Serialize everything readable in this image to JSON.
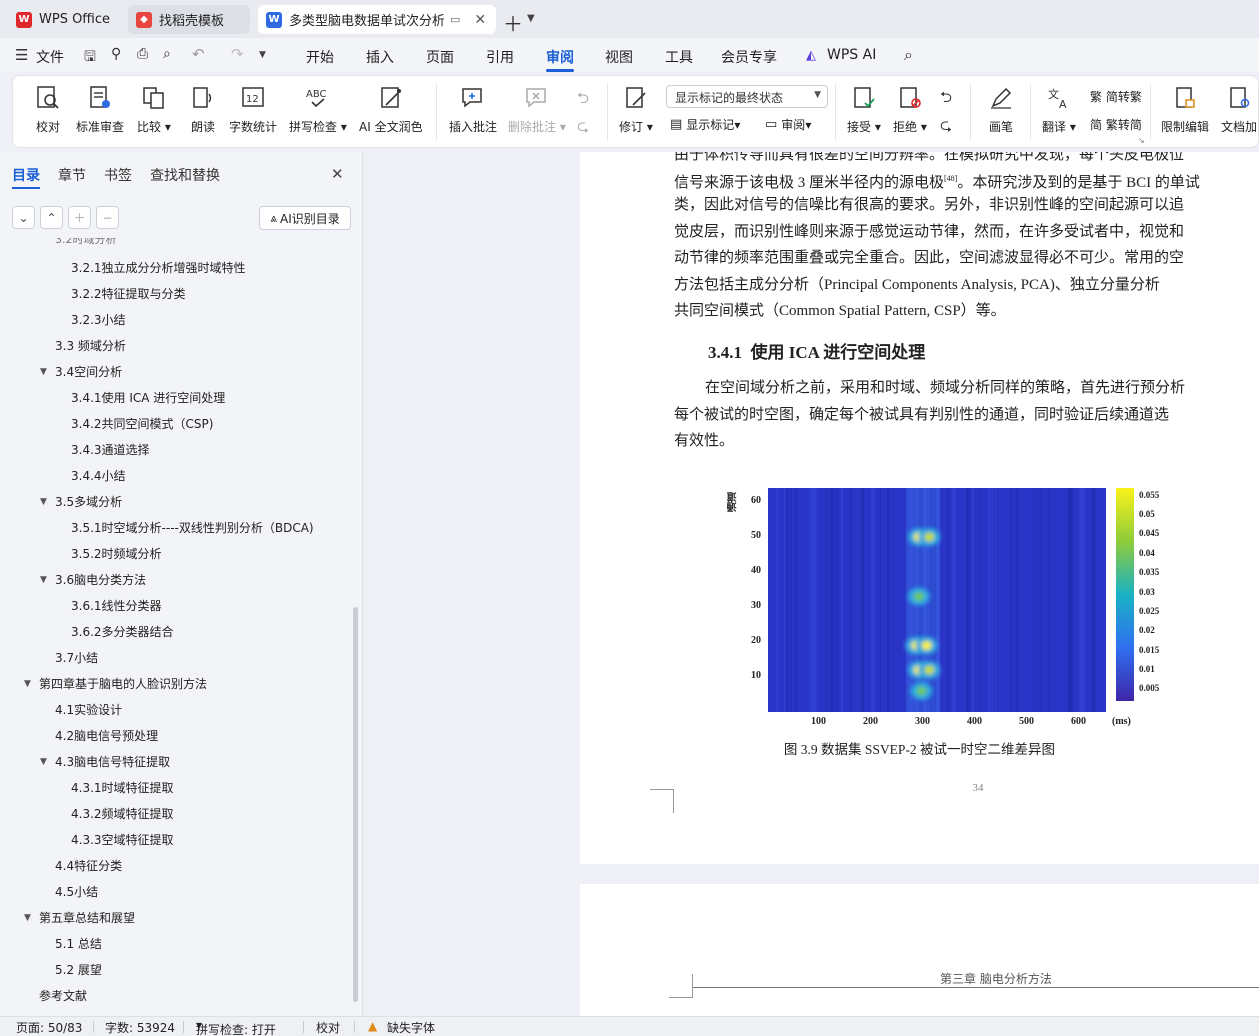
{
  "tabs": [
    {
      "label": "WPS Office"
    },
    {
      "label": "找稻壳模板"
    },
    {
      "label": "多类型脑电数据单试次分析的"
    }
  ],
  "menu": {
    "file": "文件",
    "items": [
      "开始",
      "插入",
      "页面",
      "引用",
      "审阅",
      "视图",
      "工具",
      "会员专享"
    ],
    "ai": "WPS AI"
  },
  "ribbon": {
    "proofread": "校对",
    "standard_review": "标准审查",
    "compare": "比较",
    "read_aloud": "朗读",
    "word_count": "字数统计",
    "spell_check": "拼写检查",
    "ai_polish": "AI 全文润色",
    "insert_comment": "插入批注",
    "delete_comment": "删除批注",
    "track_changes": "修订",
    "display_mode": "显示标记的最终状态",
    "show_markup": "显示标记",
    "review": "审阅",
    "accept": "接受",
    "reject": "拒绝",
    "pen": "画笔",
    "translate": "翻译",
    "to_traditional": "简转繁",
    "to_simplified": "繁转简",
    "restrict_edit": "限制编辑",
    "doc_encrypt": "文档加"
  },
  "nav": {
    "tabs": [
      "目录",
      "章节",
      "书签",
      "查找和替换"
    ],
    "ai_toc": "AI识别目录",
    "toc": [
      {
        "text": "3.2.1独立成分分析增强时域特性",
        "level": 3
      },
      {
        "text": "3.2.2特征提取与分类",
        "level": 3
      },
      {
        "text": "3.2.3小结",
        "level": 3
      },
      {
        "text": "3.3  频域分析",
        "level": 2
      },
      {
        "text": "3.4空间分析",
        "level": 2,
        "expanded": true
      },
      {
        "text": "3.4.1使用 ICA 进行空间处理",
        "level": 3
      },
      {
        "text": "3.4.2共同空间模式（CSP)",
        "level": 3
      },
      {
        "text": "3.4.3通道选择",
        "level": 3
      },
      {
        "text": "3.4.4小结",
        "level": 3
      },
      {
        "text": "3.5多域分析",
        "level": 2,
        "expanded": true
      },
      {
        "text": "3.5.1时空域分析----双线性判别分析（BDCA)",
        "level": 3
      },
      {
        "text": "3.5.2时频域分析",
        "level": 3
      },
      {
        "text": "3.6脑电分类方法",
        "level": 2,
        "expanded": true
      },
      {
        "text": "3.6.1线性分类器",
        "level": 3
      },
      {
        "text": "3.6.2多分类器结合",
        "level": 3
      },
      {
        "text": "3.7小结",
        "level": 2
      },
      {
        "text": "第四章基于脑电的人脸识别方法",
        "level": 1,
        "expanded": true
      },
      {
        "text": "4.1实验设计",
        "level": 2
      },
      {
        "text": "4.2脑电信号预处理",
        "level": 2
      },
      {
        "text": "4.3脑电信号特征提取",
        "level": 2,
        "expanded": true
      },
      {
        "text": "4.3.1时域特征提取",
        "level": 3
      },
      {
        "text": "4.3.2频域特征提取",
        "level": 3
      },
      {
        "text": "4.3.3空域特征提取",
        "level": 3
      },
      {
        "text": "4.4特征分类",
        "level": 2
      },
      {
        "text": "4.5小结",
        "level": 2
      },
      {
        "text": "第五章总结和展望",
        "level": 1,
        "expanded": true
      },
      {
        "text": "5.1  总结",
        "level": 2
      },
      {
        "text": "5.2  展望",
        "level": 2
      },
      {
        "text": "参考文献",
        "level": 1
      }
    ]
  },
  "doc": {
    "lines": [
      "由于体积传导而具有很差的空间分辨率。在模拟研究中发现，每个头皮电极位",
      "信号来源于该电极 3 厘米半径内的源电极",
      "类，因此对信号的信噪比有很高的要求。另外，非识别性峰的空间起源可以追",
      "觉皮层，而识别性峰则来源于感觉运动节律，然而，在许多受试者中，视觉和",
      "动节律的频率范围重叠或完全重合。因此，空间滤波显得必不可少。常用的空",
      "方法包括主成分分析（Principal Components Analysis, PCA)、独立分量分析",
      "共同空间模式（Common Spatial Pattern, CSP）等。"
    ],
    "cite": "[48]",
    "line2_rest": "。本研究涉及到的是基于 BCI 的单试",
    "heading_num": "3.4.1",
    "heading_text": "使用 ICA 进行空间处理",
    "para2": [
      "在空间域分析之前，采用和时域、频域分析同样的策略，首先进行预分析",
      "每个被试的时空图，确定每个被试具有判别性的通道，同时验证后续通道选",
      "有效性。"
    ],
    "caption": "图 3.9 数据集 SSVEP-2 被试一时空二维差异图",
    "page_number": "34",
    "next_header": "第三章  脑电分析方法"
  },
  "chart_data": {
    "type": "heatmap",
    "xlabel": "(ms)",
    "ylabel": "通道",
    "x_ticks": [
      100,
      200,
      300,
      400,
      500,
      600
    ],
    "y_ticks": [
      10,
      20,
      30,
      40,
      50,
      60
    ],
    "colorbar_ticks": [
      0.005,
      0.01,
      0.015,
      0.02,
      0.025,
      0.03,
      0.035,
      0.04,
      0.045,
      0.05,
      0.055
    ],
    "hotspots": [
      {
        "x": 290,
        "y": 50,
        "v": 0.055
      },
      {
        "x": 310,
        "y": 50,
        "v": 0.045
      },
      {
        "x": 290,
        "y": 33,
        "v": 0.04
      },
      {
        "x": 285,
        "y": 19,
        "v": 0.055
      },
      {
        "x": 305,
        "y": 19,
        "v": 0.05
      },
      {
        "x": 290,
        "y": 12,
        "v": 0.05
      },
      {
        "x": 310,
        "y": 12,
        "v": 0.045
      },
      {
        "x": 295,
        "y": 6,
        "v": 0.04
      }
    ]
  },
  "status": {
    "page": "页面: 50/83",
    "words": "字数: 53924",
    "spell": "拼写检查: 打开",
    "proof": "校对",
    "missing_font": "缺失字体"
  },
  "colors": {
    "accent": "#1a5fd6",
    "heatmap_bg": "#2a35c8"
  }
}
